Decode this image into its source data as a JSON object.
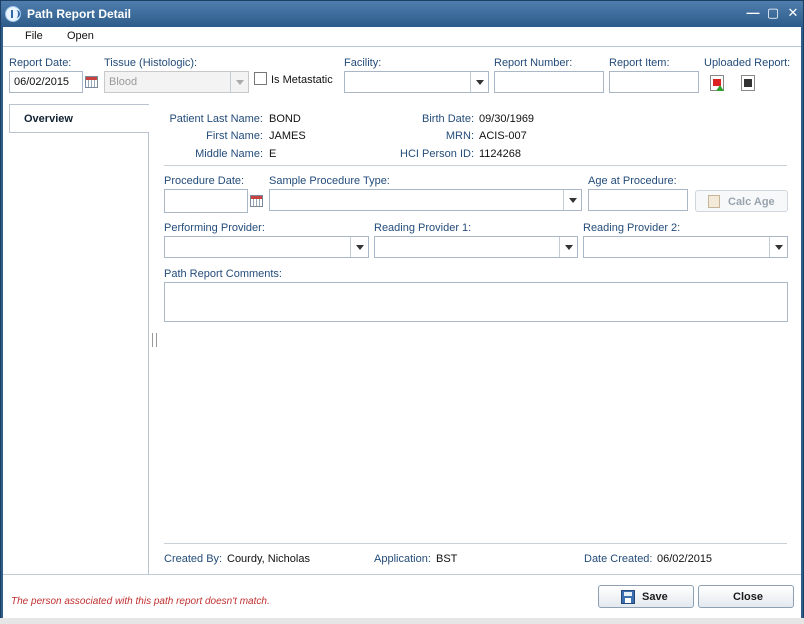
{
  "window": {
    "title": "Path Report Detail"
  },
  "menu": {
    "file": "File",
    "open": "Open"
  },
  "header": {
    "report_date_label": "Report Date:",
    "report_date_value": "06/02/2015",
    "tissue_label": "Tissue (Histologic):",
    "tissue_value": "Blood",
    "metastatic_label": "Is Metastatic",
    "facility_label": "Facility:",
    "facility_value": "",
    "report_number_label": "Report Number:",
    "report_number_value": "",
    "report_item_label": "Report Item:",
    "report_item_value": "",
    "uploaded_label": "Uploaded Report:"
  },
  "tabs": {
    "overview": "Overview"
  },
  "patient": {
    "last_name_label": "Patient Last Name:",
    "last_name": "BOND",
    "first_name_label": "First Name:",
    "first_name": "JAMES",
    "middle_name_label": "Middle Name:",
    "middle_name": "E",
    "birth_date_label": "Birth Date:",
    "birth_date": "09/30/1969",
    "mrn_label": "MRN:",
    "mrn": "ACIS-007",
    "hci_label": "HCI Person ID:",
    "hci_id": "1124268"
  },
  "procedure": {
    "date_label": "Procedure Date:",
    "date_value": "",
    "sample_type_label": "Sample Procedure Type:",
    "sample_type_value": "",
    "age_label": "Age at Procedure:",
    "age_value": "",
    "calc_age_label": "Calc Age",
    "performing_label": "Performing Provider:",
    "reading1_label": "Reading Provider 1:",
    "reading2_label": "Reading Provider 2:",
    "comments_label": "Path Report Comments:",
    "comments_value": ""
  },
  "footer": {
    "created_by_label": "Created By:",
    "created_by": "Courdy, Nicholas",
    "application_label": "Application:",
    "application": "BST",
    "date_created_label": "Date Created:",
    "date_created": "06/02/2015",
    "warning": "The person associated with this path report doesn't match.",
    "save_label": "Save",
    "close_label": "Close"
  },
  "icons": {
    "app": "app-logo-icon",
    "calendar": "calendar-icon",
    "pdf_upload": "pdf-upload-icon",
    "pdf_view": "pdf-view-icon",
    "save": "save-icon",
    "calc": "calculator-icon"
  }
}
